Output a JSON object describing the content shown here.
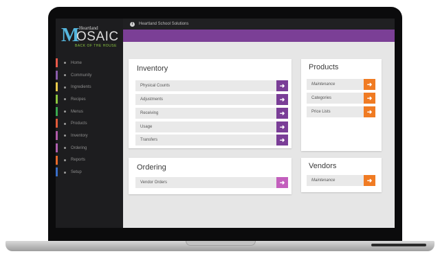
{
  "logo": {
    "small": "Heartland",
    "m": "M",
    "rest": "OSAIC",
    "tagline": "BACK OF THE HOUSE"
  },
  "header": {
    "title": "Heartland School Solutions",
    "icon": "info-icon"
  },
  "colors": {
    "accent": "#7b3f96",
    "purple_button": "#7a3e97",
    "pink_button": "#c35fbd",
    "orange_button": "#f07b23"
  },
  "sidebar": {
    "items": [
      {
        "label": "Home",
        "color": "#e8594a"
      },
      {
        "label": "Community",
        "color": "#8a5ca9"
      },
      {
        "label": "Ingredients",
        "color": "#e8c94a"
      },
      {
        "label": "Recipes",
        "color": "#8cc63f"
      },
      {
        "label": "Menus",
        "color": "#3aa84f"
      },
      {
        "label": "Products",
        "color": "#e05a3a"
      },
      {
        "label": "Inventory",
        "color": "#b05aa8"
      },
      {
        "label": "Ordering",
        "color": "#b060b0"
      },
      {
        "label": "Reports",
        "color": "#e86a2a"
      },
      {
        "label": "Setup",
        "color": "#3a6ec8"
      }
    ]
  },
  "inventory": {
    "title": "Inventory",
    "items": [
      "Physical Counts",
      "Adjustments",
      "Receiving",
      "Usage",
      "Transfers"
    ]
  },
  "ordering": {
    "title": "Ordering",
    "items": [
      "Vendor Orders"
    ]
  },
  "products": {
    "title": "Products",
    "items": [
      "Maintenance",
      "Categories",
      "Price Lists"
    ]
  },
  "vendors": {
    "title": "Vendors",
    "items": [
      "Maintenance"
    ]
  },
  "arrow_glyph": "➜"
}
